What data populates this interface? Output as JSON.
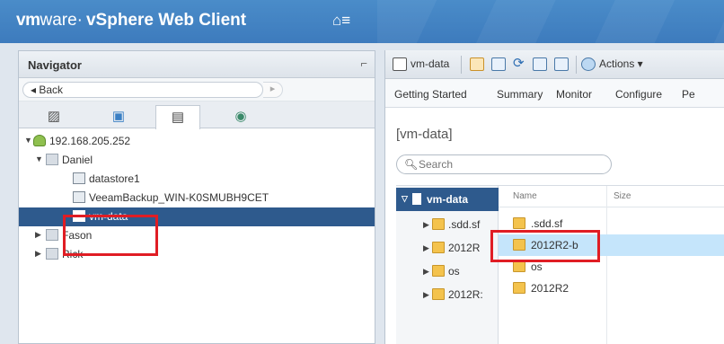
{
  "app": {
    "brand_vm": "vm",
    "brand_ware": "ware·",
    "product": "vSphere Web Client",
    "home_menu_glyph": "⌂≡"
  },
  "navigator": {
    "title": "Navigator",
    "back_label": "◂ Back",
    "forward_glyph": "▸",
    "tabs": [
      {
        "icon": "hosts-clusters-icon",
        "glyph": "▨"
      },
      {
        "icon": "vms-templates-icon",
        "glyph": "▣"
      },
      {
        "icon": "storage-icon",
        "glyph": "▤"
      },
      {
        "icon": "networking-icon",
        "glyph": "◉"
      }
    ],
    "tree": {
      "host": "192.168.205.252",
      "datacenters": [
        "Daniel",
        "Fason",
        "Rick"
      ],
      "datastores": [
        "datastore1",
        "VeeamBackup_WIN-K0SMUBH9CET",
        "vm-data"
      ]
    }
  },
  "toolbar": {
    "object": "vm-data",
    "actions_label": "Actions ▾"
  },
  "tabs": [
    "Getting Started",
    "Summary",
    "Monitor",
    "Configure",
    "Pe"
  ],
  "content": {
    "title": "[vm-data]",
    "search_placeholder": "Search"
  },
  "file_browser": {
    "root": "vm-data",
    "tree_folders": [
      ".sdd.sf",
      "2012R",
      "os",
      "2012R:"
    ],
    "columns": {
      "name": "Name",
      "size": "Size"
    },
    "files": [
      ".sdd.sf",
      "2012R2-b",
      "os",
      "2012R2"
    ],
    "selected": "2012R2-b"
  },
  "colors": {
    "header": "#3d7bbd",
    "selection": "#2e5a8d",
    "highlight_box": "#e01d24",
    "file_selected": "#c5e5fb"
  }
}
